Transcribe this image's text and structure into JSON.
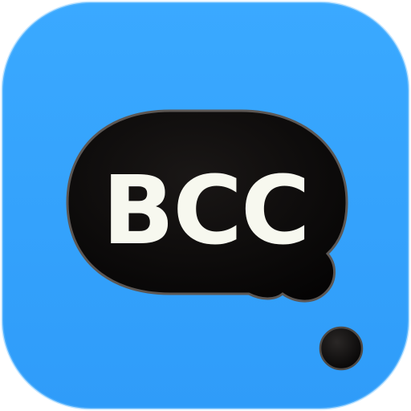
{
  "icon": {
    "label": "BCC",
    "name": "speech-bubble-app-icon",
    "colors": {
      "background": "#33a3ff",
      "background_edge": "#2b93ec",
      "bubble": "#0d0b0b",
      "bubble_rim": "#55504d",
      "text": "#f7f8ef"
    }
  }
}
